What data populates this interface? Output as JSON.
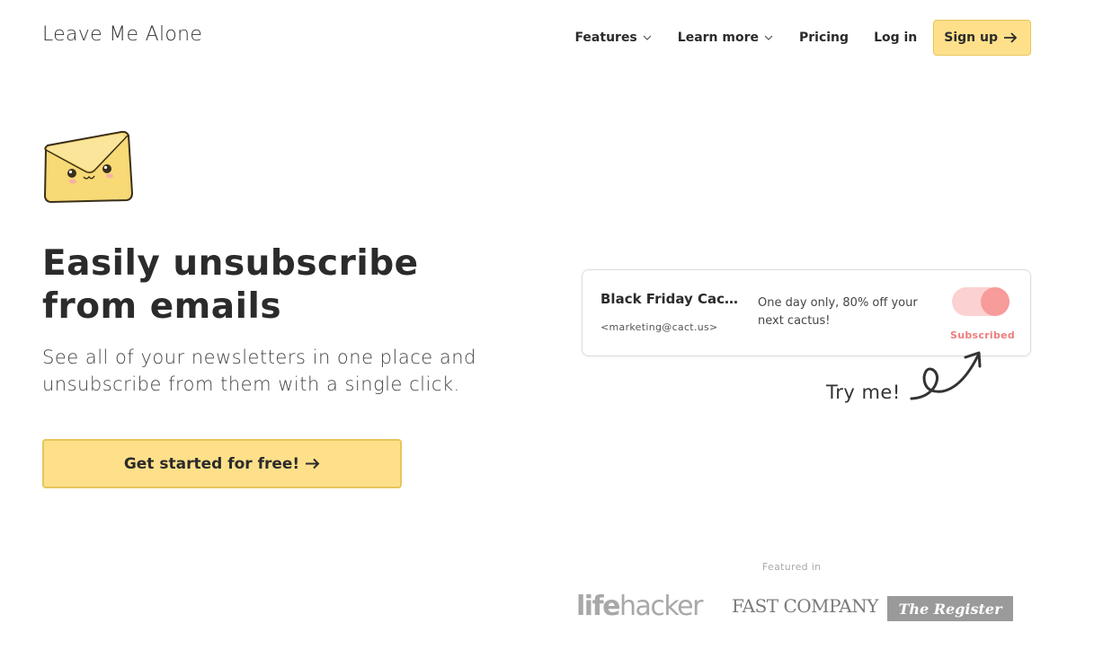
{
  "header": {
    "logo": "Leave Me Alone",
    "nav": {
      "features": "Features",
      "learn_more": "Learn more",
      "pricing": "Pricing",
      "login": "Log in",
      "signup": "Sign up"
    }
  },
  "hero": {
    "title_line1": "Easily unsubscribe",
    "title_line2": "from emails",
    "subtitle": "See all of your newsletters in one place and unsubscribe from them with a single click.",
    "cta": "Get started for free!"
  },
  "demo": {
    "from": "Black Friday Cactus",
    "email": "<marketing@cact.us>",
    "snippet": "One day only, 80% off your next cactus!",
    "status": "Subscribed",
    "toggle_on": true,
    "hint": "Try me!"
  },
  "featured": {
    "label": "Featured in",
    "logos": [
      "lifehacker",
      "FAST COMPANY",
      "The Register"
    ]
  },
  "colors": {
    "accent": "#ffe08a",
    "accent_border": "#e8c55a",
    "toggle_track": "#fcd1d1",
    "toggle_knob": "#f79b9b",
    "status": "#ee7d7d"
  }
}
